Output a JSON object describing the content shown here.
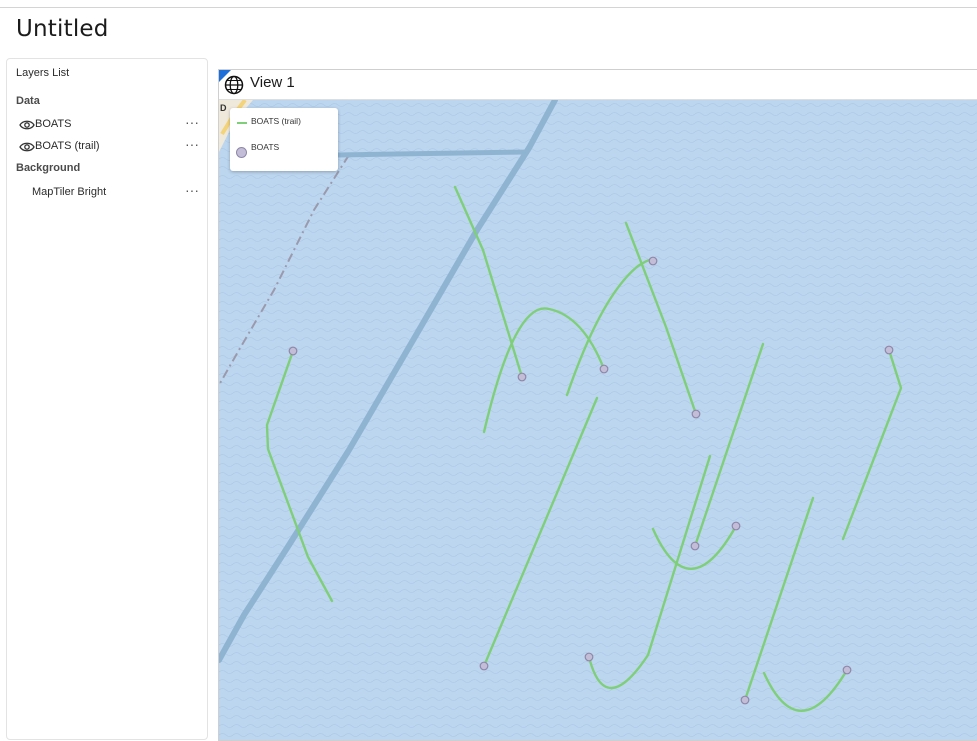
{
  "app": {
    "title": "Untitled"
  },
  "layers_panel": {
    "title": "Layers List",
    "sections": [
      {
        "title": "Data",
        "items": [
          {
            "label": "BOATS",
            "visible": true
          },
          {
            "label": "BOATS (trail)",
            "visible": true
          }
        ]
      },
      {
        "title": "Background",
        "items": [
          {
            "label": "MapTiler Bright"
          }
        ]
      }
    ],
    "more_glyph": "···"
  },
  "view": {
    "title": "View 1",
    "map_edge_label": "D",
    "legend": {
      "items": [
        {
          "label": "BOATS (trail)",
          "symbol": "line",
          "color": "#7fcf79"
        },
        {
          "label": "BOATS",
          "symbol": "circle",
          "color": "#c4bdd8"
        }
      ]
    }
  },
  "colors": {
    "water": "#bcd6f0",
    "trail": "#7fcf79",
    "boat_fill": "#c4bdd8",
    "boat_stroke": "#8e87a8",
    "shipping_lane": "#8fb4d2",
    "accent": "#1f6fd8"
  },
  "icons": {
    "view": "globe-icon",
    "visibility": "eye-icon",
    "menu": "more-options-icon"
  }
}
